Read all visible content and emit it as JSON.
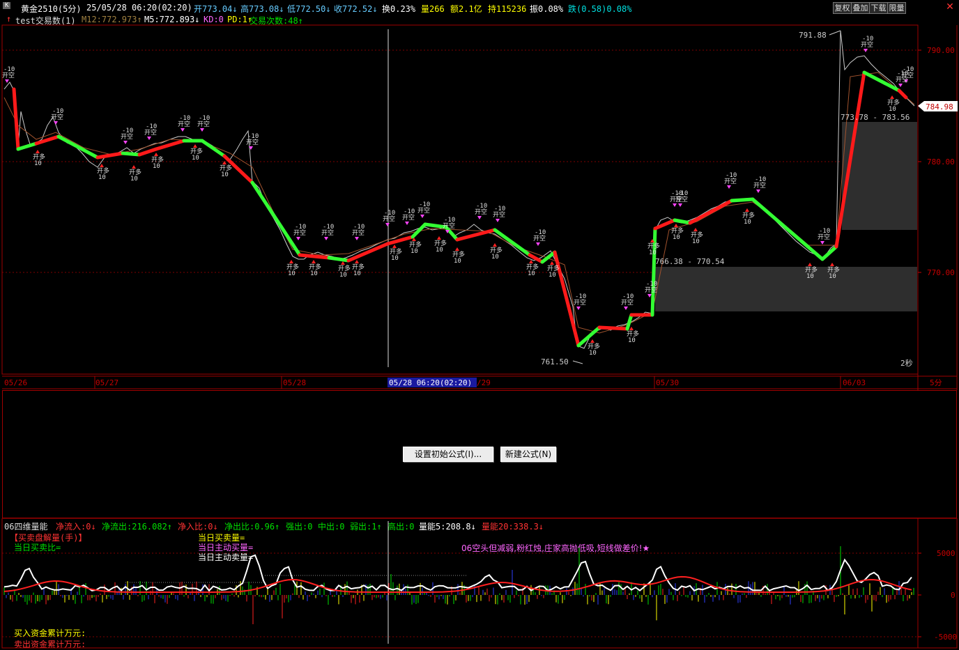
{
  "colors": {
    "up": "#ff3333",
    "down": "#00e000",
    "axis": "#c80000",
    "price": "#66ccff",
    "yellow": "#ffff00",
    "magenta": "#ff66ff",
    "grid": "#800000"
  },
  "header": {
    "logo": "K",
    "symbol": "黄金2510(5分)",
    "datetime": "25/05/28 06:20(02:20)",
    "open": "开773.04↓",
    "high": "高773.08↓",
    "low": "低772.50↓",
    "close": "收772.52↓",
    "turnover": "换0.23%",
    "volume": "量266",
    "amount": "额2.1亿",
    "position": "持115236",
    "amplitude": "振0.08%",
    "change": "跌(0.58)0.08%",
    "buttons": [
      "复权",
      "叠加",
      "下载",
      "限量"
    ]
  },
  "indicator": {
    "name": "test交易数(1)",
    "m12": "M12:772.973↑",
    "m5": "M5:772.893↓",
    "kd": "KD:0",
    "pd": "PD:1↑",
    "count": "交易次数:48↑"
  },
  "price_axis": {
    "labels": [
      "790.00",
      "780.00",
      "770.00"
    ],
    "current": "784.98"
  },
  "annotations": {
    "high": "791.88",
    "low": "761.50",
    "zone1": "773.78 - 783.56",
    "zone2": "766.38 - 770.54",
    "timer": "2秒"
  },
  "marker_text": {
    "sell": "-10 开空",
    "buy": "开多 10"
  },
  "dates": [
    "05/26",
    "05/27",
    "05/28",
    "05/28 06:20(02:20)",
    "/29",
    "05/30",
    "06/03"
  ],
  "period": "5分",
  "mid_panel": {
    "set_formula": "设置初始公式(I)...",
    "new_formula": "新建公式(N)"
  },
  "volume_panel": {
    "title": "06四维量能",
    "net_in": "净流入:0↓",
    "net_out": "净流出:216.082↑",
    "net_in_ratio": "净入比:0↓",
    "net_out_ratio": "净出比:0.96↑",
    "strong_out": "强出:0",
    "mid_out": "中出:0",
    "weak_out": "弱出:1↑",
    "high_out": "高出:0",
    "vol5": "量能5:208.8↓",
    "vol20": "量能20:338.3↓",
    "legend_left": [
      "【买卖盘解量(手)】",
      "当日买卖比="
    ],
    "legend_mid": [
      "当日买卖量=",
      "当日主动买量=",
      "当日主动卖量="
    ],
    "message": "06空头但减弱,粉红烛,庄家高抛低吸,短线做差价!★",
    "axis": [
      "5000",
      "0",
      "-5000"
    ],
    "bottom": [
      "买入资金累计万元:",
      "卖出资金累计万元:"
    ]
  }
}
